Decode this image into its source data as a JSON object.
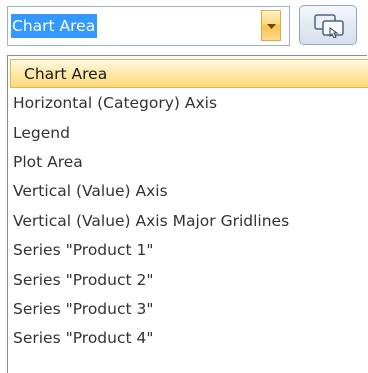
{
  "combo": {
    "value": "Chart Area",
    "arrow_icon": "chevron-down-icon"
  },
  "help_button": {
    "icon": "help-icon"
  },
  "dropdown": {
    "items": [
      {
        "label": "Chart Area",
        "selected": true
      },
      {
        "label": "Horizontal (Category) Axis"
      },
      {
        "label": "Legend"
      },
      {
        "label": "Plot Area"
      },
      {
        "label": "Vertical (Value) Axis"
      },
      {
        "label": "Vertical (Value) Axis Major Gridlines"
      },
      {
        "label": "Series \"Product 1\""
      },
      {
        "label": "Series \"Product 2\""
      },
      {
        "label": "Series \"Product 3\""
      },
      {
        "label": "Series \"Product 4\""
      }
    ]
  },
  "colors": {
    "selection_blue": "#3399ff",
    "hover_gold": "#ffe9a8",
    "text": "#333333"
  }
}
